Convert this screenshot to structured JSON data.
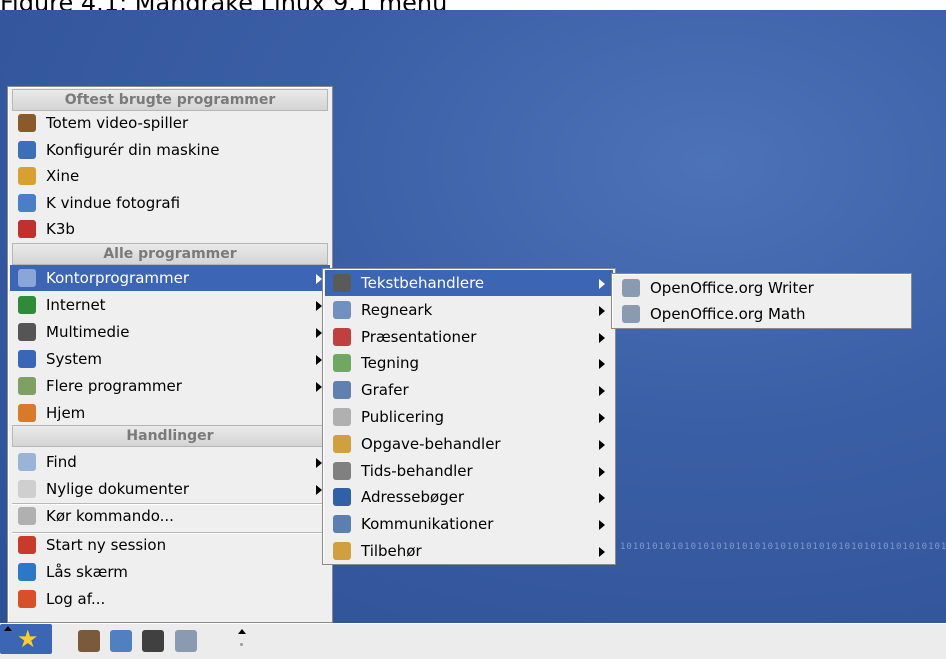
{
  "caption_fragment": "Figure 4.1: Mandrake Linux 9.1 menu",
  "desktop": {
    "binary_text": "1010101010101010101010101010101010101010101010101010"
  },
  "main_menu": {
    "section_frequent": "Oftest brugte programmer",
    "frequent": [
      {
        "label": "Totem video-spiller",
        "icon": "totem-icon",
        "color": "#8a5a2b"
      },
      {
        "label": "Konfigurér din maskine",
        "icon": "config-icon",
        "color": "#3b6fb8"
      },
      {
        "label": "Xine",
        "icon": "xine-icon",
        "color": "#d8a030"
      },
      {
        "label": "K vindue fotografi",
        "icon": "ksnapshot-icon",
        "color": "#4a7fc8"
      },
      {
        "label": "K3b",
        "icon": "k3b-icon",
        "color": "#c0302c"
      }
    ],
    "section_all": "Alle programmer",
    "all": [
      {
        "label": "Kontorprogrammer",
        "icon": "office-icon",
        "color": "#8aa6d6",
        "submenu": true,
        "highlighted": true
      },
      {
        "label": "Internet",
        "icon": "globe-icon",
        "color": "#2f8a3a",
        "submenu": true
      },
      {
        "label": "Multimedie",
        "icon": "multimedia-icon",
        "color": "#555555",
        "submenu": true
      },
      {
        "label": "System",
        "icon": "system-icon",
        "color": "#3a66b8",
        "submenu": true
      },
      {
        "label": "Flere programmer",
        "icon": "more-programs-icon",
        "color": "#7fa060",
        "submenu": true
      },
      {
        "label": "Hjem",
        "icon": "home-icon",
        "color": "#d87a2a",
        "submenu": false
      }
    ],
    "section_actions": "Handlinger",
    "actions": [
      {
        "label": "Find",
        "icon": "magnifier-icon",
        "color": "#9ab4d8",
        "submenu": true
      },
      {
        "label": "Nylige dokumenter",
        "icon": "document-icon",
        "color": "#cfcfcf",
        "submenu": true
      },
      {
        "label": "Kør kommando...",
        "icon": "gear-icon",
        "color": "#b0b0b0",
        "submenu": false
      },
      {
        "label": "Start ny session",
        "icon": "rocket-icon",
        "color": "#c83a2a",
        "submenu": false
      },
      {
        "label": "Lås skærm",
        "icon": "lock-icon",
        "color": "#2b78c8",
        "submenu": false
      },
      {
        "label": "Log af...",
        "icon": "power-icon",
        "color": "#d8502a",
        "submenu": false
      }
    ]
  },
  "sub_menu": {
    "items": [
      {
        "label": "Tekstbehandlere",
        "icon": "wordprocessor-icon",
        "color": "#5a5a5a",
        "highlighted": true
      },
      {
        "label": "Regneark",
        "icon": "spreadsheet-icon",
        "color": "#7090c0"
      },
      {
        "label": "Præsentationer",
        "icon": "presentation-icon",
        "color": "#c04040"
      },
      {
        "label": "Tegning",
        "icon": "drawing-icon",
        "color": "#70a860"
      },
      {
        "label": "Grafer",
        "icon": "graph-icon",
        "color": "#6080b0"
      },
      {
        "label": "Publicering",
        "icon": "publishing-icon",
        "color": "#b0b0b0"
      },
      {
        "label": "Opgave-behandler",
        "icon": "task-icon",
        "color": "#d0a040"
      },
      {
        "label": "Tids-behandler",
        "icon": "clock-icon",
        "color": "#808080"
      },
      {
        "label": "Adressebøger",
        "icon": "addressbook-icon",
        "color": "#3060a8"
      },
      {
        "label": "Kommunikationer",
        "icon": "communication-icon",
        "color": "#5a7fb0"
      },
      {
        "label": "Tilbehør",
        "icon": "accessories-icon",
        "color": "#d0a040"
      }
    ]
  },
  "sub_sub_menu": {
    "items": [
      {
        "label": "OpenOffice.org Writer",
        "icon": "oo-writer-icon",
        "color": "#8a9ab0"
      },
      {
        "label": "OpenOffice.org Math",
        "icon": "oo-math-icon",
        "color": "#8a9ab0"
      }
    ]
  },
  "taskbar": {
    "launchers": [
      {
        "icon": "konqueror-icon",
        "color": "#7a5a3a"
      },
      {
        "icon": "network-icon",
        "color": "#5080c0"
      },
      {
        "icon": "terminal-icon",
        "color": "#404040"
      },
      {
        "icon": "writer-launcher-icon",
        "color": "#8a9ab0"
      }
    ]
  }
}
